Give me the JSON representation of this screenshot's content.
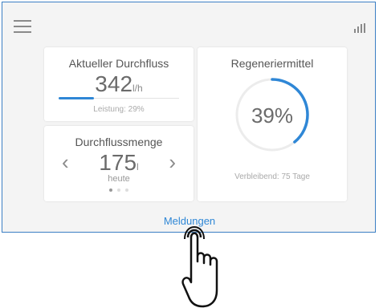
{
  "header": {
    "menu_icon": "hamburger-menu-icon",
    "signal_icon": "signal-strength-icon"
  },
  "flow_card": {
    "title": "Aktueller Durchfluss",
    "value": "342",
    "unit": "l/h",
    "performance_label": "Leistung: 29%",
    "performance_fraction": 0.29
  },
  "amount_card": {
    "title": "Durchflussmenge",
    "value": "175",
    "unit": "l",
    "period": "heute",
    "prev_label": "‹",
    "next_label": "›",
    "pages": 3,
    "active_page": 0
  },
  "regen_card": {
    "title": "Regeneriermittel",
    "percent_label": "39%",
    "fraction": 0.39,
    "remaining_label": "Verbleibend: 75 Tage"
  },
  "footer": {
    "link_label": "Meldungen"
  },
  "overlay": {
    "hand_icon": "tap-hand-icon"
  },
  "colors": {
    "accent": "#2f87d6",
    "frame": "#3b7fc4",
    "background": "#f4f4f4",
    "card": "#ffffff"
  }
}
